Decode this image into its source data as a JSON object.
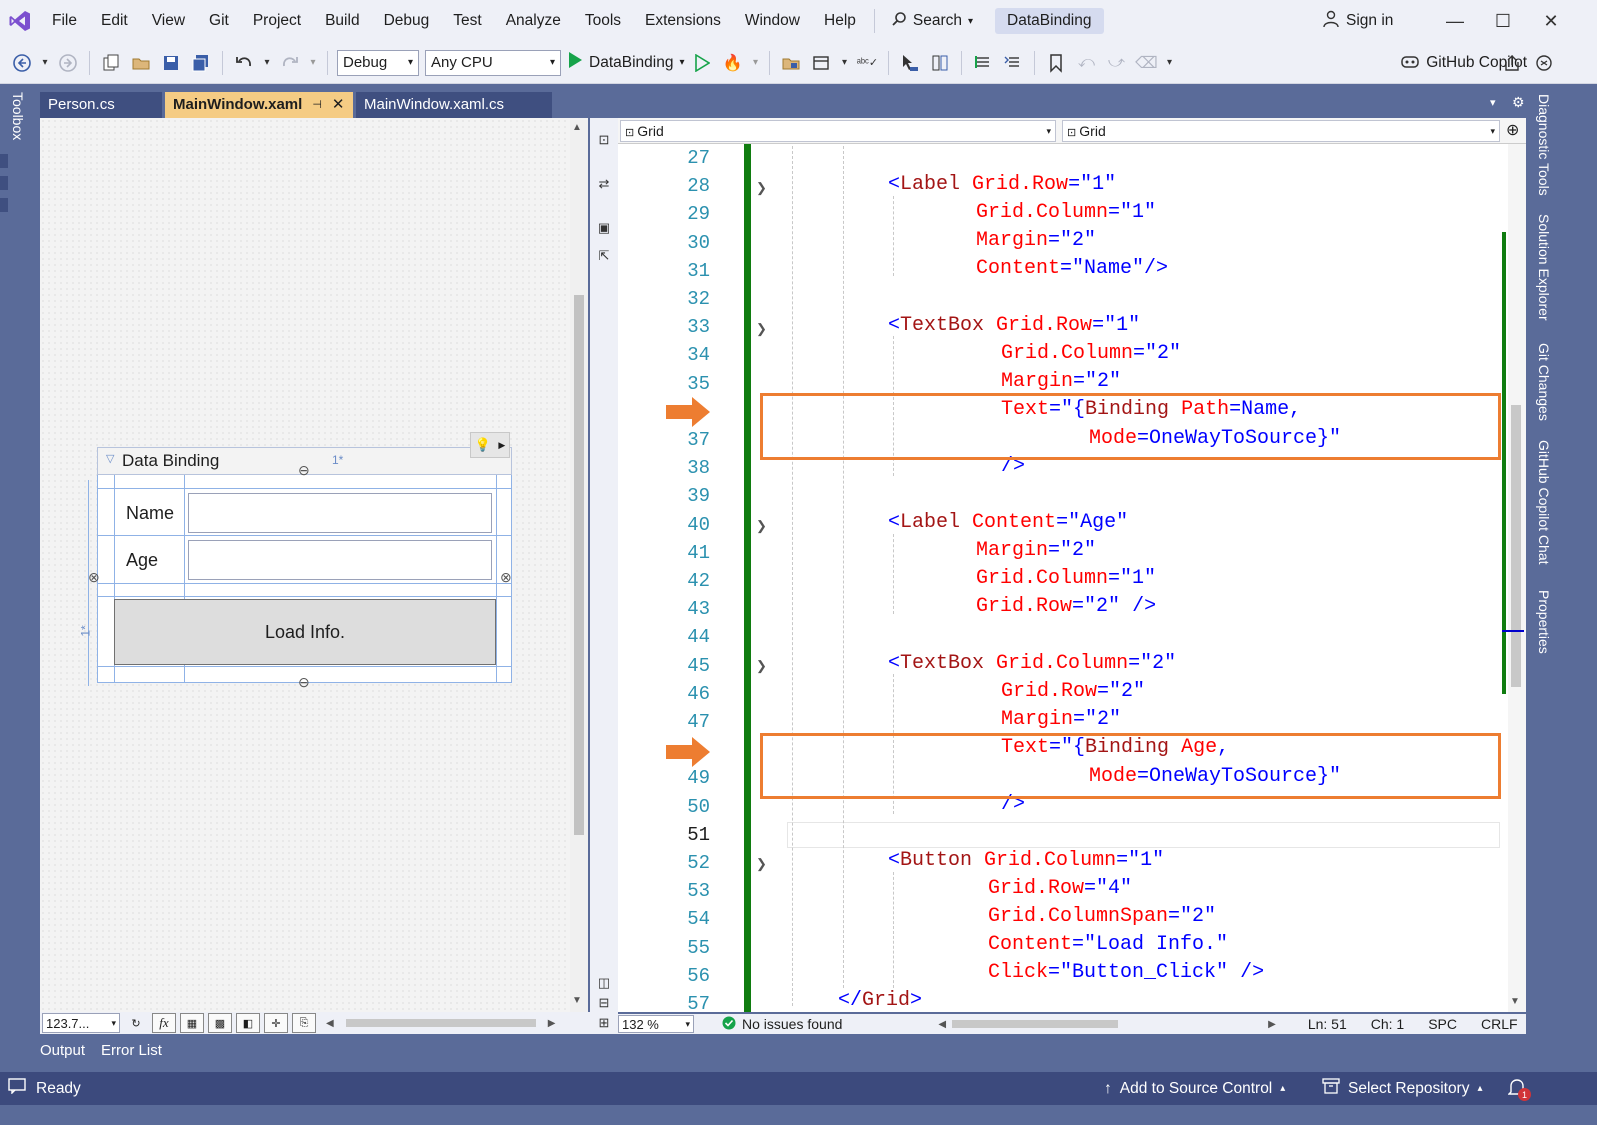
{
  "menu": {
    "items": [
      "File",
      "Edit",
      "View",
      "Git",
      "Project",
      "Build",
      "Debug",
      "Test",
      "Analyze",
      "Tools",
      "Extensions",
      "Window",
      "Help"
    ],
    "search_label": "Search",
    "app_title": "DataBinding",
    "signin_label": "Sign in"
  },
  "toolbar": {
    "config": "Debug",
    "platform": "Any CPU",
    "run_label": "DataBinding",
    "copilot_label": "GitHub Copilot"
  },
  "left_strip": {
    "toolbox_label": "Toolbox"
  },
  "tabs": [
    {
      "label": "Person.cs",
      "active": false
    },
    {
      "label": "MainWindow.xaml",
      "active": true
    },
    {
      "label": "MainWindow.xaml.cs",
      "active": false
    }
  ],
  "designer": {
    "window_title": "Data Binding",
    "name_label": "Name",
    "age_label": "Age",
    "button_label": "Load Info.",
    "star_top": "1*",
    "star_side": "1*",
    "zoom": "123.7..."
  },
  "editor": {
    "nav_left": "Grid",
    "nav_right": "Grid",
    "zoom": "132 %",
    "issues": "No issues found",
    "ln": "Ln: 51",
    "ch": "Ch: 1",
    "spc": "SPC",
    "eol": "CRLF",
    "line_numbers": [
      "27",
      "28",
      "29",
      "30",
      "31",
      "32",
      "33",
      "34",
      "35",
      "",
      "37",
      "38",
      "39",
      "40",
      "41",
      "42",
      "43",
      "44",
      "45",
      "46",
      "47",
      "",
      "49",
      "50",
      "51",
      "52",
      "53",
      "54",
      "55",
      "56",
      "57"
    ]
  },
  "right_rail": [
    "Diagnostic Tools",
    "Solution Explorer",
    "Git Changes",
    "GitHub Copilot Chat",
    "Properties"
  ],
  "bottom_tabs": [
    "Output",
    "Error List"
  ],
  "status": {
    "ready": "Ready",
    "add_source": "Add to Source Control",
    "select_repo": "Select Repository",
    "notif_count": "1"
  },
  "colors": {
    "accent": "#ed7d31",
    "green_gutter": "#107c10",
    "statusbar": "#3c4a7d",
    "tab_active": "#f5cc84"
  }
}
